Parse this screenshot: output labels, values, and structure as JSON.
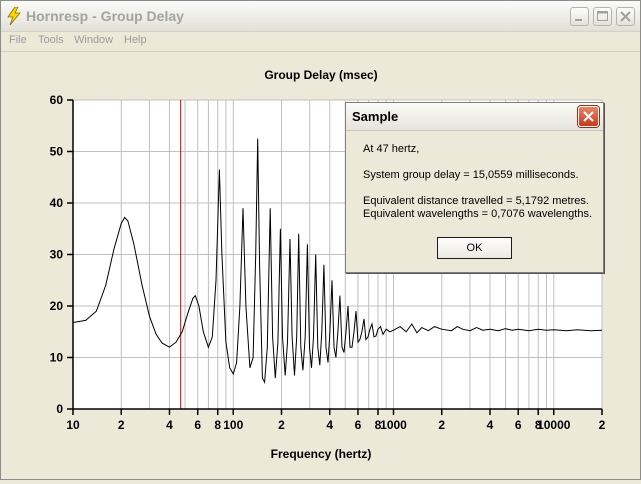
{
  "window": {
    "title": "Hornresp - Group Delay",
    "menu": [
      "File",
      "Tools",
      "Window",
      "Help"
    ]
  },
  "chart_data": {
    "type": "line",
    "title": "Group Delay (msec)",
    "xlabel": "Frequency (hertz)",
    "ylabel": "",
    "x_scale": "log",
    "xlim": [
      10,
      20000
    ],
    "ylim": [
      0,
      60
    ],
    "y_ticks": [
      "0",
      "10",
      "20",
      "30",
      "40",
      "50",
      "60"
    ],
    "x_tick_labels": [
      {
        "f": 10,
        "label": "10"
      },
      {
        "f": 20,
        "label": "2"
      },
      {
        "f": 40,
        "label": "4"
      },
      {
        "f": 60,
        "label": "6"
      },
      {
        "f": 80,
        "label": "8"
      },
      {
        "f": 100,
        "label": "100"
      },
      {
        "f": 200,
        "label": "2"
      },
      {
        "f": 400,
        "label": "4"
      },
      {
        "f": 600,
        "label": "6"
      },
      {
        "f": 800,
        "label": "8"
      },
      {
        "f": 1000,
        "label": "1000"
      },
      {
        "f": 2000,
        "label": "2"
      },
      {
        "f": 4000,
        "label": "4"
      },
      {
        "f": 6000,
        "label": "6"
      },
      {
        "f": 8000,
        "label": "8"
      },
      {
        "f": 10000,
        "label": "10000"
      },
      {
        "f": 20000,
        "label": "2"
      }
    ],
    "grid": true,
    "cursor_x": 47,
    "series": [
      {
        "values": [
          [
            10,
            16.8
          ],
          [
            12,
            17.2
          ],
          [
            14,
            19
          ],
          [
            16,
            24
          ],
          [
            18,
            31
          ],
          [
            20,
            36
          ],
          [
            21,
            37.2
          ],
          [
            22,
            36.5
          ],
          [
            24,
            32
          ],
          [
            27,
            24
          ],
          [
            30,
            18
          ],
          [
            33,
            14.5
          ],
          [
            36,
            12.8
          ],
          [
            40,
            12
          ],
          [
            44,
            13
          ],
          [
            48,
            15
          ],
          [
            52,
            18.5
          ],
          [
            56,
            21.5
          ],
          [
            58,
            22
          ],
          [
            61,
            20
          ],
          [
            65,
            15
          ],
          [
            70,
            12
          ],
          [
            74,
            14
          ],
          [
            78,
            25
          ],
          [
            82,
            46.5
          ],
          [
            85,
            30
          ],
          [
            90,
            13
          ],
          [
            95,
            8
          ],
          [
            100,
            6.8
          ],
          [
            105,
            9
          ],
          [
            110,
            20
          ],
          [
            115,
            39
          ],
          [
            120,
            20
          ],
          [
            127,
            8
          ],
          [
            133,
            10
          ],
          [
            138,
            30
          ],
          [
            142,
            52.5
          ],
          [
            146,
            28
          ],
          [
            152,
            6
          ],
          [
            157,
            5.2
          ],
          [
            163,
            12
          ],
          [
            170,
            39
          ],
          [
            176,
            14
          ],
          [
            183,
            6
          ],
          [
            190,
            13
          ],
          [
            197,
            35
          ],
          [
            203,
            14
          ],
          [
            211,
            6.5
          ],
          [
            218,
            13
          ],
          [
            226,
            33
          ],
          [
            233,
            14
          ],
          [
            241,
            6.5
          ],
          [
            249,
            14
          ],
          [
            256,
            34
          ],
          [
            264,
            12
          ],
          [
            272,
            7.5
          ],
          [
            281,
            14
          ],
          [
            290,
            32
          ],
          [
            299,
            12
          ],
          [
            308,
            8
          ],
          [
            317,
            14
          ],
          [
            327,
            30
          ],
          [
            337,
            12
          ],
          [
            347,
            8.5
          ],
          [
            357,
            15
          ],
          [
            368,
            28
          ],
          [
            379,
            12
          ],
          [
            390,
            9
          ],
          [
            401,
            15
          ],
          [
            413,
            25
          ],
          [
            425,
            12
          ],
          [
            437,
            10
          ],
          [
            450,
            15
          ],
          [
            463,
            22
          ],
          [
            477,
            12
          ],
          [
            491,
            11
          ],
          [
            505,
            15
          ],
          [
            520,
            20
          ],
          [
            535,
            12
          ],
          [
            551,
            12
          ],
          [
            567,
            15
          ],
          [
            583,
            19
          ],
          [
            600,
            13
          ],
          [
            617,
            13.5
          ],
          [
            635,
            15
          ],
          [
            654,
            17.5
          ],
          [
            673,
            13.5
          ],
          [
            693,
            14
          ],
          [
            713,
            15.5
          ],
          [
            734,
            16.5
          ],
          [
            756,
            14
          ],
          [
            778,
            14.2
          ],
          [
            800,
            15.5
          ],
          [
            830,
            16
          ],
          [
            860,
            14.5
          ],
          [
            900,
            15.5
          ],
          [
            950,
            15
          ],
          [
            1000,
            15.3
          ],
          [
            1100,
            16
          ],
          [
            1200,
            15
          ],
          [
            1300,
            16.5
          ],
          [
            1400,
            14.8
          ],
          [
            1500,
            15.8
          ],
          [
            1650,
            15.2
          ],
          [
            1800,
            16
          ],
          [
            2000,
            15.5
          ],
          [
            2300,
            15.2
          ],
          [
            2500,
            16
          ],
          [
            2700,
            15.5
          ],
          [
            3000,
            15.2
          ],
          [
            3300,
            15.8
          ],
          [
            3600,
            15.3
          ],
          [
            4000,
            15.5
          ],
          [
            4500,
            15.2
          ],
          [
            5000,
            15.6
          ],
          [
            5500,
            15.3
          ],
          [
            6000,
            15.5
          ],
          [
            7000,
            15.2
          ],
          [
            8000,
            15.5
          ],
          [
            9000,
            15.3
          ],
          [
            10000,
            15.4
          ],
          [
            12000,
            15.2
          ],
          [
            14000,
            15.4
          ],
          [
            17000,
            15.2
          ],
          [
            20000,
            15.3
          ]
        ]
      }
    ]
  },
  "dialog": {
    "title": "Sample",
    "line1": "At 47 hertz,",
    "line2": "System group delay = 15,0559 milliseconds.",
    "line3": "Equivalent distance travelled = 5,1792 metres.",
    "line4": "Equivalent wavelengths = 0,7076 wavelengths.",
    "ok_label": "OK"
  },
  "colors": {
    "curve": "#000000",
    "cursor": "#cc0000",
    "grid": "#c0c0c0",
    "plot_background": "#ffffff",
    "window_background": "#ece9d8"
  }
}
